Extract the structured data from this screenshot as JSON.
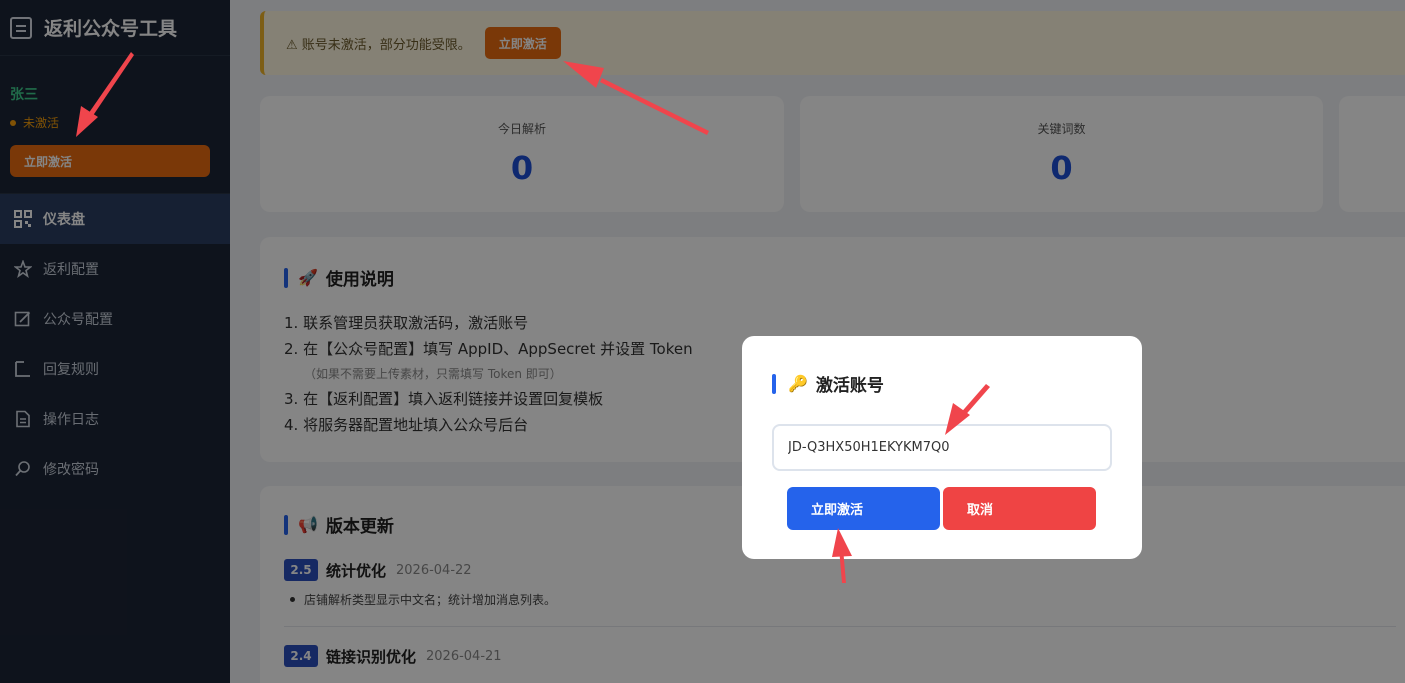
{
  "sidebar": {
    "title": "返利公众号工具",
    "user_name": "张三",
    "user_status": "未激活",
    "activate_label": "立即激活",
    "items": [
      {
        "label": "仪表盘",
        "icon": "dashboard-icon"
      },
      {
        "label": "返利配置",
        "icon": "star-icon"
      },
      {
        "label": "公众号配置",
        "icon": "edit-icon"
      },
      {
        "label": "回复规则",
        "icon": "reply-icon"
      },
      {
        "label": "操作日志",
        "icon": "log-icon"
      },
      {
        "label": "修改密码",
        "icon": "key-icon"
      }
    ]
  },
  "warning": {
    "text": "⚠ 账号未激活，部分功能受限。",
    "button_label": "立即激活"
  },
  "stats": [
    {
      "label": "今日解析",
      "value": "0"
    },
    {
      "label": "关键词数",
      "value": "0"
    }
  ],
  "usage": {
    "title": "使用说明",
    "steps": [
      "1. 联系管理员获取激活码，激活账号",
      "2. 在【公众号配置】填写 AppID、AppSecret 并设置 Token",
      "3. 在【返利配置】填入返利链接并设置回复模板",
      "4. 将服务器配置地址填入公众号后台"
    ],
    "note": "（如果不需要上传素材，只需填写 Token 即可）"
  },
  "updates": {
    "title": "版本更新",
    "versions": [
      {
        "version": "2.5",
        "title": "统计优化",
        "date": "2026-04-22",
        "desc": "店铺解析类型显示中文名；统计增加消息列表。"
      },
      {
        "version": "2.4",
        "title": "链接识别优化",
        "date": "2026-04-21"
      }
    ]
  },
  "modal": {
    "title": "激活账号",
    "input_value": "JD-Q3HX50H1EKYKM7Q0",
    "confirm_label": "立即激活",
    "cancel_label": "取消"
  },
  "colors": {
    "sidebar_bg": "#1c2536",
    "accent_orange": "#ea6c10",
    "primary_blue": "#2563eb",
    "danger_red": "#ef4444",
    "annotation_red": "#f0454c"
  }
}
